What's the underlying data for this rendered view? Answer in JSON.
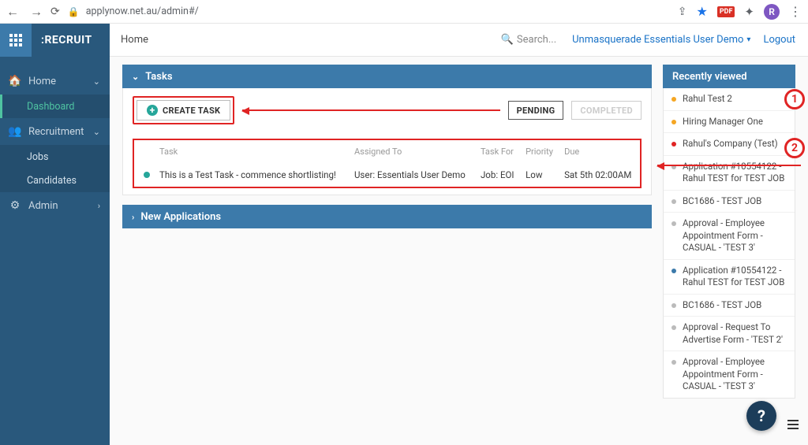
{
  "browser": {
    "url": "applynow.net.au/admin#/",
    "avatar_letter": "R",
    "ext_label": "PDF"
  },
  "brand": ":RECRUIT",
  "crumb": "Home",
  "search_placeholder": "Search...",
  "user_link": "Unmasquerade Essentials User Demo",
  "logout": "Logout",
  "sidebar": {
    "home": "Home",
    "dashboard": "Dashboard",
    "recruitment": "Recruitment",
    "jobs": "Jobs",
    "candidates": "Candidates",
    "admin": "Admin"
  },
  "tasks": {
    "header": "Tasks",
    "create": "CREATE TASK",
    "pending": "PENDING",
    "completed": "COMPLETED",
    "cols": {
      "task": "Task",
      "assigned": "Assigned To",
      "for": "Task For",
      "priority": "Priority",
      "due": "Due"
    },
    "row": {
      "task": "This is a Test Task - commence shortlisting!",
      "assigned": "User: Essentials User Demo",
      "for": "Job: EOI",
      "priority": "Low",
      "due": "Sat 5th 02:00AM"
    }
  },
  "new_apps": "New Applications",
  "recent": {
    "header": "Recently viewed",
    "items": [
      {
        "color": "orange",
        "text": "Rahul Test 2"
      },
      {
        "color": "orange",
        "text": "Hiring Manager One"
      },
      {
        "color": "red",
        "text": "Rahul's Company (Test)"
      },
      {
        "color": "grey",
        "text": "Application #10554122 - Rahul TEST for TEST JOB"
      },
      {
        "color": "grey",
        "text": "BC1686 - TEST JOB"
      },
      {
        "color": "grey",
        "text": "Approval - Employee Appointment Form - CASUAL - 'TEST 3'"
      },
      {
        "color": "blue",
        "text": "Application #10554122 - Rahul TEST for TEST JOB"
      },
      {
        "color": "grey",
        "text": "BC1686 - TEST JOB"
      },
      {
        "color": "grey",
        "text": "Approval - Request To Advertise Form - 'TEST 2'"
      },
      {
        "color": "grey",
        "text": "Approval - Employee Appointment Form - CASUAL - 'TEST 3'"
      }
    ]
  },
  "annotations": {
    "one": "1",
    "two": "2"
  },
  "help": "?"
}
